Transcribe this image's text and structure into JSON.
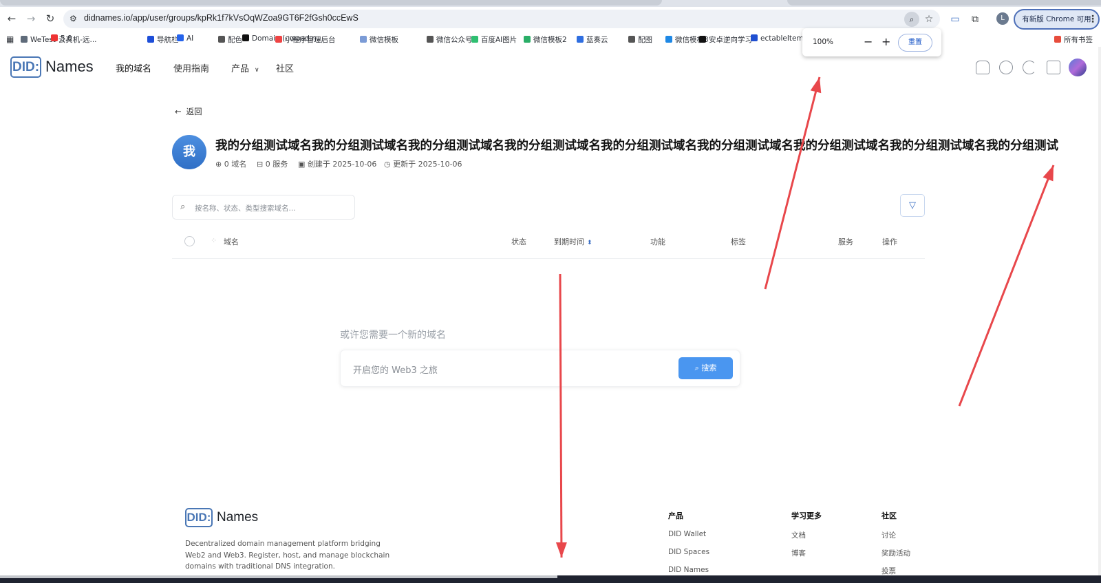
{
  "browser": {
    "url": "didnames.io/app/user/groups/kpRk1f7kVsOqWZoa9GT6F2fGsh0ccEwS",
    "update_label": "有新版 Chrome 可用",
    "profile_initial": "L",
    "bookmarks": [
      "WeTest-云真机-远...",
      "5.0",
      "导航栏",
      "AI",
      "配色",
      "Domain (cmpad.n...",
      "小程序管理后台",
      "微信模板",
      "微信公众号",
      "百度AI图片",
      "微信模板2",
      "蓝奏云",
      "配图",
      "微信模板3",
      "安卓逆向学习",
      "ectableItemBa...",
      "所有书签"
    ],
    "bookmark_colors": [
      "#5f6b7a",
      "#e33",
      "#1d4ed8",
      "#2563eb",
      "#555",
      "#111",
      "#e44",
      "#7b9bd6",
      "#555",
      "#2fbf71",
      "#2aae67",
      "#2f6ee0",
      "#555",
      "#1e88e5",
      "#111",
      "#1f4fd1",
      "#e74c3c"
    ],
    "zoom": {
      "value": "100%",
      "minus": "−",
      "plus": "+",
      "reset": "重置"
    }
  },
  "header": {
    "logo_mark": "DID:",
    "logo_word": "Names",
    "nav": [
      "我的域名",
      "使用指南",
      "产品",
      "社区"
    ]
  },
  "page": {
    "back_label": "返回",
    "group_avatar": "我",
    "group_title": "我的分组测试域名我的分组测试域名我的分组测试域名我的分组测试域名我的分组测试域名我的分组测试域名我的分组测试域名我的分组测试域名我的分组测试",
    "meta": {
      "domains": "0 域名",
      "services": "0 服务",
      "created": "创建于 2025-10-06",
      "updated": "更新于 2025-10-06"
    },
    "search_placeholder": "按名称、状态、类型搜索域名...",
    "columns": [
      "域名",
      "状态",
      "到期时间",
      "功能",
      "标签",
      "服务",
      "操作"
    ],
    "empty": {
      "title": "或许您需要一个新的域名",
      "placeholder": "开启您的 Web3 之旅",
      "button": "搜索"
    }
  },
  "footer": {
    "logo_mark": "DID:",
    "logo_word": "Names",
    "description": "Decentralized domain management platform bridging Web2 and Web3. Register, host, and manage blockchain domains with traditional DNS integration.",
    "columns": [
      {
        "title": "产品",
        "links": [
          "DID Wallet",
          "DID Spaces",
          "DID Names"
        ]
      },
      {
        "title": "学习更多",
        "links": [
          "文档",
          "博客"
        ]
      },
      {
        "title": "社区",
        "links": [
          "讨论",
          "奖励活动",
          "投票"
        ]
      }
    ]
  },
  "annotation_color": "#e8474b"
}
